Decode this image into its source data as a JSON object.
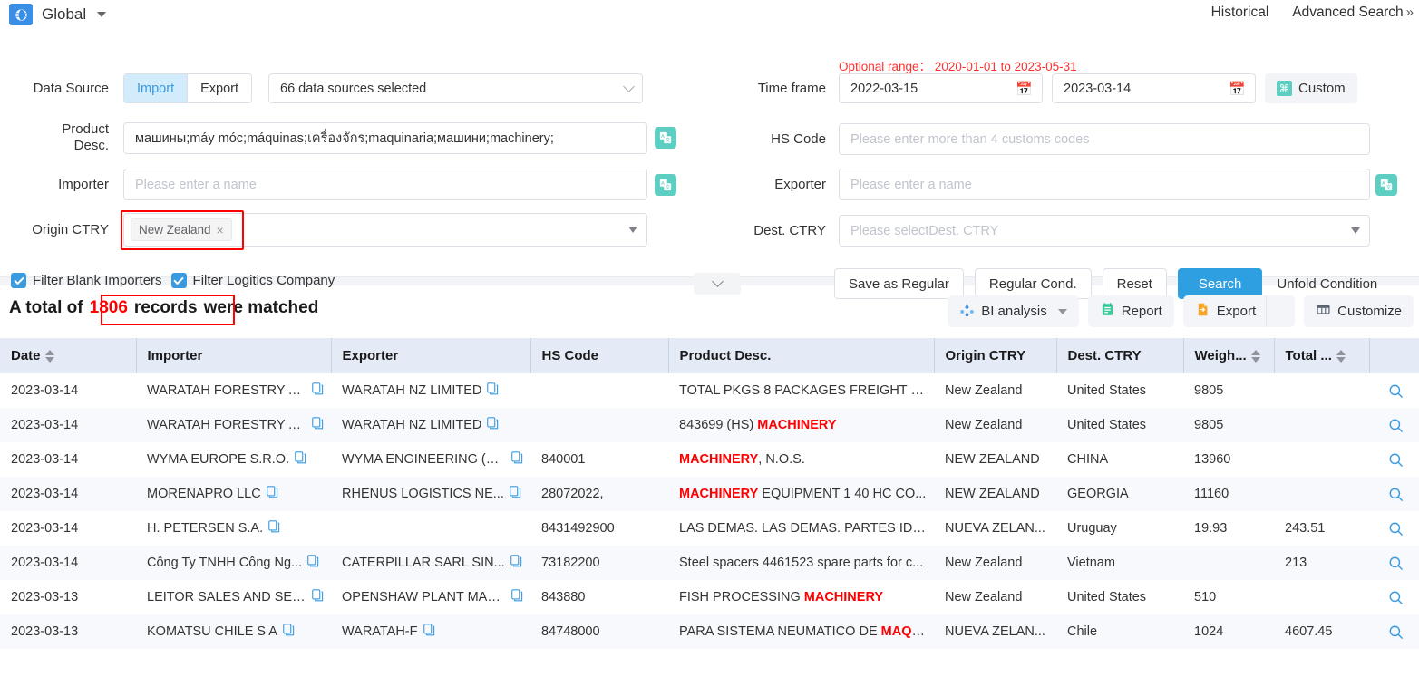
{
  "topbar": {
    "globe_label": "Global",
    "historical": "Historical",
    "advanced_search": "Advanced Search",
    "advanced_chevron": "»"
  },
  "filters": {
    "data_source": {
      "label": "Data Source",
      "import_label": "Import",
      "export_label": "Export",
      "sources_value": "66 data sources selected"
    },
    "product_desc": {
      "label_line1": "Product",
      "label_line2": "Desc.",
      "value": "машины;máy móc;máquinas;เครื่องจักร;maquinaria;машини;machinery;"
    },
    "importer": {
      "label": "Importer",
      "placeholder": "Please enter a name",
      "value": ""
    },
    "origin_ctry": {
      "label": "Origin CTRY",
      "tags": [
        "New Zealand"
      ]
    },
    "time_frame": {
      "label": "Time frame",
      "optional_range": "Optional range： 2020-01-01 to 2023-05-31",
      "start": "2022-03-15",
      "end": "2023-03-14",
      "custom_label": "Custom"
    },
    "hs_code": {
      "label": "HS Code",
      "placeholder": "Please enter more than 4 customs codes",
      "value": ""
    },
    "exporter": {
      "label": "Exporter",
      "placeholder": "Please enter a name",
      "value": ""
    },
    "dest_ctry": {
      "label": "Dest. CTRY",
      "placeholder": "Please selectDest. CTRY",
      "value": ""
    },
    "checkboxes": [
      {
        "label": "Filter Blank Importers",
        "checked": true
      },
      {
        "label": "Filter Logitics Company",
        "checked": true
      }
    ],
    "buttons": {
      "save_as_regular": "Save as Regular",
      "regular_cond": "Regular Cond.",
      "reset": "Reset",
      "search": "Search",
      "unfold_condition": "Unfold Condition"
    }
  },
  "results": {
    "total_prefix": "A total of",
    "total_count": "1806",
    "total_records_word": "records",
    "total_suffix": "were matched",
    "toolbar": {
      "bi_analysis": "BI analysis",
      "report": "Report",
      "export": "Export",
      "customize": "Customize"
    }
  },
  "table": {
    "columns": [
      {
        "label": "Date",
        "sortable": true
      },
      {
        "label": "Importer",
        "sortable": false
      },
      {
        "label": "Exporter",
        "sortable": false
      },
      {
        "label": "HS Code",
        "sortable": false
      },
      {
        "label": "Product Desc.",
        "sortable": false
      },
      {
        "label": "Origin CTRY",
        "sortable": false
      },
      {
        "label": "Dest. CTRY",
        "sortable": false
      },
      {
        "label": "Weigh...",
        "sortable": true
      },
      {
        "label": "Total ...",
        "sortable": true
      },
      {
        "label": "",
        "sortable": false
      }
    ],
    "rows": [
      {
        "date": "2023-03-14",
        "importer": "WARATAH FORESTRY AT...",
        "exporter": "WARATAH NZ LIMITED",
        "hs_code": "",
        "product_parts": [
          {
            "t": "TOTAL PKGS 8 PACKAGES FREIGHT PR...",
            "hl": false
          }
        ],
        "origin": "New Zealand",
        "dest": "United States",
        "weight": "9805",
        "total": ""
      },
      {
        "date": "2023-03-14",
        "importer": "WARATAH FORESTRY AT...",
        "exporter": "WARATAH NZ LIMITED",
        "hs_code": "",
        "product_parts": [
          {
            "t": "843699 (HS) ",
            "hl": false
          },
          {
            "t": "MACHINERY",
            "hl": true
          }
        ],
        "origin": "New Zealand",
        "dest": "United States",
        "weight": "9805",
        "total": ""
      },
      {
        "date": "2023-03-14",
        "importer": "WYMA EUROPE S.R.O.",
        "exporter": "WYMA ENGINEERING (N...",
        "hs_code": "840001",
        "product_parts": [
          {
            "t": "MACHINERY",
            "hl": true
          },
          {
            "t": ", N.O.S.",
            "hl": false
          }
        ],
        "origin": "NEW ZEALAND",
        "dest": "CHINA",
        "weight": "13960",
        "total": ""
      },
      {
        "date": "2023-03-14",
        "importer": "MORENAPRO LLC",
        "exporter": "RHENUS LOGISTICS NE...",
        "hs_code": "28072022,",
        "product_parts": [
          {
            "t": "MACHINERY",
            "hl": true
          },
          {
            "t": " EQUIPMENT 1 40 HC CO...",
            "hl": false
          }
        ],
        "origin": "NEW ZEALAND",
        "dest": "GEORGIA",
        "weight": "11160",
        "total": ""
      },
      {
        "date": "2023-03-14",
        "importer": "H. PETERSEN S.A.",
        "exporter": "",
        "hs_code": "8431492900",
        "product_parts": [
          {
            "t": "LAS DEMAS. LAS DEMAS. PARTES IDEN...",
            "hl": false
          }
        ],
        "origin": "NUEVA ZELAN...",
        "dest": "Uruguay",
        "weight": "19.93",
        "total": "243.51"
      },
      {
        "date": "2023-03-14",
        "importer": "Công Ty TNHH Công Ng...",
        "exporter": "CATERPILLAR SARL SIN...",
        "hs_code": "73182200",
        "product_parts": [
          {
            "t": "Steel spacers 4461523 spare parts for c...",
            "hl": false
          }
        ],
        "origin": "New Zealand",
        "dest": "Vietnam",
        "weight": "",
        "total": "213"
      },
      {
        "date": "2023-03-13",
        "importer": "LEITOR SALES AND SER...",
        "exporter": "OPENSHAW PLANT MAC...",
        "hs_code": "843880",
        "product_parts": [
          {
            "t": "FISH PROCESSING ",
            "hl": false
          },
          {
            "t": "MACHINERY",
            "hl": true
          }
        ],
        "origin": "New Zealand",
        "dest": "United States",
        "weight": "510",
        "total": ""
      },
      {
        "date": "2023-03-13",
        "importer": "KOMATSU CHILE S A",
        "exporter": "WARATAH-F",
        "hs_code": "84748000",
        "product_parts": [
          {
            "t": "PARA SISTEMA NEUMATICO DE ",
            "hl": false
          },
          {
            "t": "MAQU",
            "hl": true
          },
          {
            "t": "...",
            "hl": false
          }
        ],
        "origin": "NUEVA ZELAN...",
        "dest": "Chile",
        "weight": "1024",
        "total": "4607.45"
      }
    ]
  },
  "colors": {
    "accent_blue": "#2e9fe0",
    "danger_red": "#ff0000",
    "teal": "#5ccfc2",
    "header_bg": "#e4eaf6"
  }
}
